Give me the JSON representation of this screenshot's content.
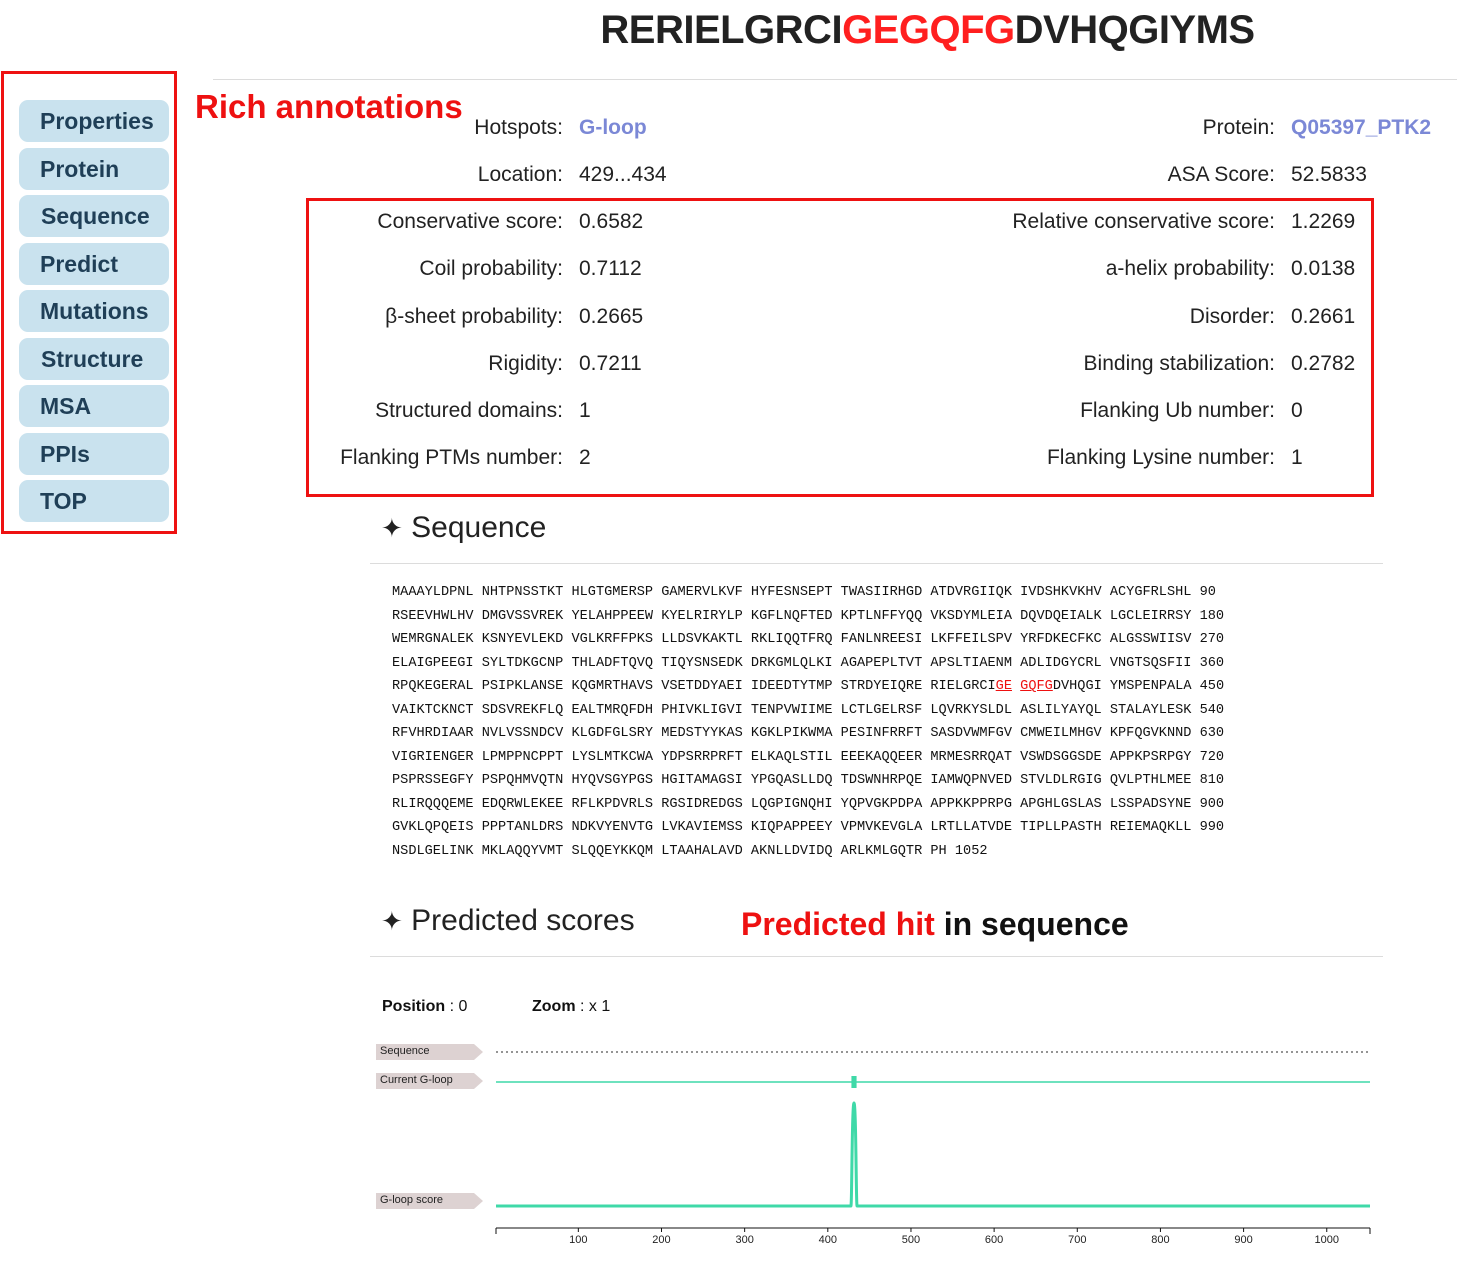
{
  "header": {
    "seq_before": "RERIELGRCI",
    "seq_hit": "GEGQFG",
    "seq_after": "DVHQGIYMS"
  },
  "sidebar": {
    "items": [
      {
        "label": "Properties"
      },
      {
        "label": "Protein"
      },
      {
        "label": "Sequence"
      },
      {
        "label": "Predict"
      },
      {
        "label": "Mutations"
      },
      {
        "label": "Structure"
      },
      {
        "label": "MSA"
      },
      {
        "label": "PPIs"
      },
      {
        "label": "TOP"
      }
    ]
  },
  "notes": {
    "rich_annotations": "Rich annotations",
    "predicted_hit": "Predicted hit",
    "in_sequence": " in sequence"
  },
  "properties": {
    "hotspots_label": "Hotspots:",
    "hotspots_value": "G-loop",
    "protein_label": "Protein:",
    "protein_value": "Q05397_PTK2",
    "location_label": "Location:",
    "location_value": "429...434",
    "asa_label": "ASA Score:",
    "asa_value": "52.5833"
  },
  "annotations": {
    "left": [
      {
        "label": "Conservative score:",
        "value": "0.6582"
      },
      {
        "label": "Coil probability:",
        "value": "0.7112"
      },
      {
        "label": "β-sheet probability:",
        "value": "0.2665"
      },
      {
        "label": "Rigidity:",
        "value": "0.7211"
      },
      {
        "label": "Structured domains:",
        "value": "1"
      },
      {
        "label": "Flanking PTMs number:",
        "value": "2"
      }
    ],
    "right": [
      {
        "label": "Relative conservative score:",
        "value": "1.2269"
      },
      {
        "label": "a-helix probability:",
        "value": "0.0138"
      },
      {
        "label": "Disorder:",
        "value": "0.2661"
      },
      {
        "label": "Binding stabilization:",
        "value": "0.2782"
      },
      {
        "label": "Flanking Ub number:",
        "value": "0"
      },
      {
        "label": "Flanking Lysine number:",
        "value": "1"
      }
    ]
  },
  "sequence_section": {
    "heading": "Sequence",
    "star": "✦",
    "lines": [
      "MAAAYLDPNL NHTPNSSTKT HLGTGMERSP GAMERVLKVF HYFESNSEPT TWASIIRHGD ATDVRGIIQK IVDSHKVKHV ACYGFRLSHL 90",
      "RSEEVHWLHV DMGVSSVREK YELAHPPEEW KYELRIRYLP KGFLNQFTED KPTLNFFYQQ VKSDYMLEIA DQVDQEIALK LGCLEIRRSY 180",
      "WEMRGNALEK KSNYEVLEKD VGLKRFFPKS LLDSVKAKTL RKLIQQTFRQ FANLNREESI LKFFEILSPV YRFDKECFKC ALGSSWIISV 270",
      "ELAIGPEEGI SYLTDKGCNP THLADFTQVQ TIQYSNSEDK DRKGMLQLKI AGAPEPLTVT APSLTIAENM ADLIDGYCRL VNGTSQSFII 360",
      "",
      "VAIKTCKNCT SDSVREKFLQ EALTMRQFDH PHIVKLIGVI TENPVWIIME LCTLGELRSF LQVRKYSLDL ASLILYAYQL STALAYLESK 540",
      "RFVHRDIAAR NVLVSSNDCV KLGDFGLSRY MEDSTYYKAS KGKLPIKWMA PESINFRRFT SASDVWMFGV CMWEILMHGV KPFQGVKNND 630",
      "VIGRIENGER LPMPPNCPPT LYSLMTKCWA YDPSRRPRFT ELKAQLSTIL EEEKAQQEER MRMESRRQAT VSWDSGGSDE APPKPSRPGY 720",
      "PSPRSSEGFY PSPQHMVQTN HYQVSGYPGS HGITAMAGSI YPGQASLLDQ TDSWNHRPQE IAMWQPNVED STVLDLRGIG QVLPTHLMEE 810",
      "RLIRQQQEME EDQRWLEKEE RFLKPDVRLS RGSIDREDGS LQGPIGNQHI YQPVGKPDPA APPKKPPRPG APGHLGSLAS LSSPADSYNE 900",
      "GVKLQPQEIS PPPTANLDRS NDKVYENVTG LVKAVIEMSS KIQPAPPEEY VPMVKEVGLA LRTLLATVDE TIPLLPASTH REIEMAQKLL 990",
      "NSDLGELINK MKLAQQYVMT SLQQEYKKQM LTAAHALAVD AKNLLDVIDQ ARLKMLGQTR PH 1052"
    ],
    "hit_line": {
      "before": "RPQKEGERAL PSIPKLANSE KQGMRTHAVS VSETDDYAEI IDEEDTYTMP STRDYEIQRE RIELGRCI",
      "hit1": "GE",
      "mid": " ",
      "hit2": "GQFG",
      "after": "DVHQGI YMSPENPALA 450"
    }
  },
  "predicted_section": {
    "heading": "Predicted scores",
    "star": "✦",
    "position_label": "Position",
    "position_value": ": 0",
    "zoom_label": "Zoom",
    "zoom_value": ": x 1"
  },
  "chart_data": {
    "type": "line",
    "tracks": [
      "Sequence",
      "Current G-loop",
      "G-loop score"
    ],
    "x_range": [
      1,
      1052
    ],
    "x_ticks": [
      100,
      200,
      300,
      400,
      500,
      600,
      700,
      800,
      900,
      1000
    ],
    "current_hit": {
      "start": 429,
      "end": 434
    },
    "score_peak": {
      "start": 429,
      "end": 434,
      "value": 1.0
    },
    "colors": {
      "track_line": "#3fd9a8",
      "tag_fill": "#ddd2d2",
      "dotted": "#555555"
    }
  }
}
